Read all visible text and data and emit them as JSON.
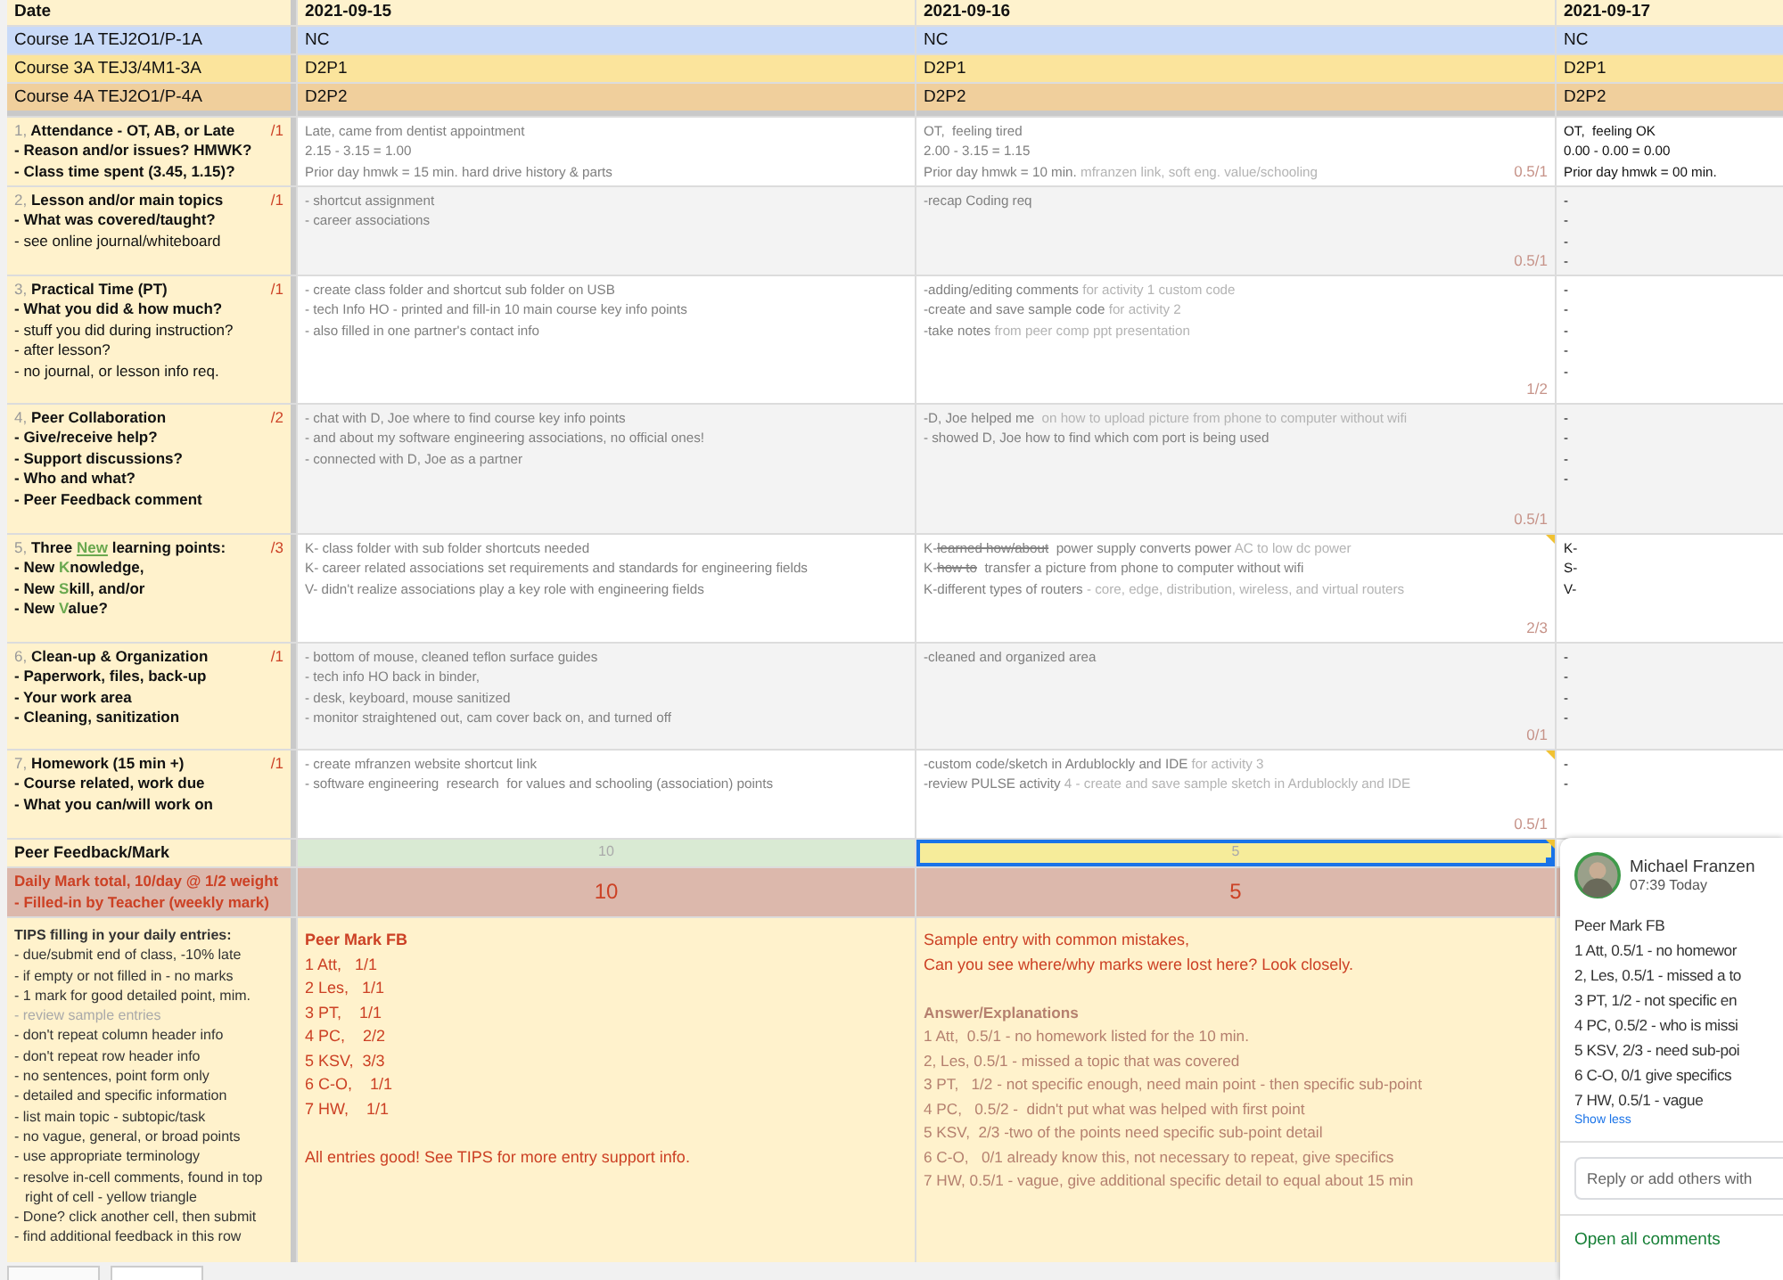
{
  "date_row": {
    "label": "Date",
    "dates": [
      "2021-09-15",
      "2021-09-16",
      "2021-09-17"
    ]
  },
  "courses": [
    {
      "label": "Course 1A TEJ2O1/P-1A",
      "values": [
        "NC",
        "NC",
        "NC"
      ],
      "color": "#c9daf8"
    },
    {
      "label": "Course 3A TEJ3/4M1-3A",
      "values": [
        "D2P1",
        "D2P1",
        "D2P1"
      ],
      "color": "#fbe49c"
    },
    {
      "label": "Course 4A TEJ2O1/P-4A",
      "values": [
        "D2P2",
        "D2P2",
        "D2P2"
      ],
      "color": "#f0cf9c"
    }
  ],
  "criteria": [
    {
      "number": "1,",
      "title": [
        {
          "text": "Attendance - OT, AB, or Late"
        }
      ],
      "max": "/1",
      "shaded": false,
      "lines": [
        {
          "text": "- Reason and/or issues? HMWK?",
          "bold": true
        },
        {
          "text": "- Class time spent (3.45, 1.15)?",
          "bold": true
        }
      ],
      "cells": [
        {
          "greyed": true,
          "lines": [
            "Late, came from dentist appointment",
            "2.15 - 3.15 = 1.00",
            "Prior day hmwk = 15 min. hard drive history & parts"
          ]
        },
        {
          "greyed": true,
          "lines": [
            "OT,  feeling tired",
            "2.00 - 3.15 = 1.15",
            [
              {
                "text": "Prior day hmwk = 10 min. "
              },
              {
                "text": "mfranzen link, soft eng. value/schooling",
                "kind": "faint"
              }
            ]
          ],
          "score": "0.5/1"
        },
        {
          "greyed": false,
          "lines": [
            "OT,  feeling OK",
            "0.00 - 0.00 = 0.00",
            "Prior day hmwk = 00 min."
          ]
        }
      ]
    },
    {
      "number": "2,",
      "title": [
        {
          "text": "Lesson and/or main topics"
        }
      ],
      "max": "/1",
      "shaded": true,
      "lines": [
        {
          "text": "- What was covered/taught?",
          "bold": true
        },
        {
          "text": "- see online journal/whiteboard",
          "bold": false
        }
      ],
      "cells": [
        {
          "greyed": true,
          "lines": [
            "- shortcut assignment",
            "- career associations"
          ]
        },
        {
          "greyed": true,
          "lines": [
            "-recap Coding req"
          ],
          "score": "0.5/1"
        },
        {
          "greyed": false,
          "lines": [
            "-",
            "-",
            "-",
            "-"
          ]
        }
      ]
    },
    {
      "number": "3,",
      "title": [
        {
          "text": "Practical Time (PT)"
        }
      ],
      "max": "/1",
      "shaded": false,
      "lines": [
        {
          "text": "- What you did & how much?",
          "bold": true
        },
        {
          "text": "- stuff you did during instruction?",
          "bold": false
        },
        {
          "text": "- after lesson?",
          "bold": false
        },
        {
          "text": "- no journal, or lesson info req.",
          "bold": false
        }
      ],
      "cells": [
        {
          "greyed": true,
          "lines": [
            "- create class folder and shortcut sub folder on USB",
            "- tech Info HO - printed and fill-in 10 main course key info points",
            "- also filled in one partner's contact info"
          ]
        },
        {
          "greyed": true,
          "lines": [
            [
              {
                "text": "-adding/editing comments "
              },
              {
                "text": "for activity 1 custom code",
                "kind": "faint"
              }
            ],
            [
              {
                "text": "-create and save sample code "
              },
              {
                "text": "for activity 2",
                "kind": "faint"
              }
            ],
            [
              {
                "text": "-take notes "
              },
              {
                "text": "from peer comp ppt presentation",
                "kind": "faint"
              }
            ]
          ],
          "score": "1/2"
        },
        {
          "greyed": false,
          "lines": [
            "-",
            "-",
            "-",
            "-",
            "-"
          ]
        }
      ]
    },
    {
      "number": "4,",
      "title": [
        {
          "text": "Peer Collaboration"
        }
      ],
      "max": "/2",
      "shaded": true,
      "lines": [
        {
          "text": "- Give/receive help?",
          "bold": true
        },
        {
          "text": "- Support discussions?",
          "bold": true
        },
        {
          "text": "- Who and what?",
          "bold": true
        },
        {
          "text": "- Peer Feedback comment",
          "bold": true
        }
      ],
      "cells": [
        {
          "greyed": true,
          "lines": [
            "- chat with D, Joe where to find course key info points",
            "- and about my software engineering associations, no official ones!",
            "- connected with D, Joe as a partner"
          ]
        },
        {
          "greyed": true,
          "lines": [
            [
              {
                "text": "-D, Joe helped me  "
              },
              {
                "text": "on how to upload picture from phone to computer without wifi",
                "kind": "faint"
              }
            ],
            "- showed D, Joe how to find which com port is being used"
          ],
          "score": "0.5/1"
        },
        {
          "greyed": false,
          "lines": [
            "-",
            "-",
            "-",
            "-"
          ]
        }
      ]
    },
    {
      "number": "5,",
      "title": [
        {
          "text": "Three "
        },
        {
          "text": "New",
          "kind": "accent-underline"
        },
        {
          "text": " learning points:"
        }
      ],
      "max": "/3",
      "shaded": false,
      "lines": [
        {
          "segments": [
            {
              "text": "- New "
            },
            {
              "text": "K",
              "kind": "accent"
            },
            {
              "text": "nowledge,"
            }
          ],
          "bold": true
        },
        {
          "segments": [
            {
              "text": "- New "
            },
            {
              "text": "S",
              "kind": "accent"
            },
            {
              "text": "kill, and/or"
            }
          ],
          "bold": true
        },
        {
          "segments": [
            {
              "text": "- New "
            },
            {
              "text": "V",
              "kind": "accent"
            },
            {
              "text": "alue?"
            }
          ],
          "bold": true
        }
      ],
      "cells": [
        {
          "greyed": true,
          "lines": [
            "K- class folder with sub folder shortcuts needed",
            "K- career related associations set requirements and standards for engineering fields",
            "V- didn't realize associations play a key role with engineering fields"
          ]
        },
        {
          "greyed": true,
          "lines": [
            [
              {
                "text": "K-"
              },
              {
                "text": "learned how/about",
                "kind": "struck"
              },
              {
                "text": "  power supply converts power "
              },
              {
                "text": "AC to low dc power",
                "kind": "faint"
              }
            ],
            [
              {
                "text": "K-"
              },
              {
                "text": "how to",
                "kind": "struck"
              },
              {
                "text": "  transfer a picture from phone to computer without wifi"
              }
            ],
            [
              {
                "text": "K-different types of routers "
              },
              {
                "text": "- core, edge, distribution, wireless, and virtual routers",
                "kind": "faint"
              }
            ]
          ],
          "score": "2/3",
          "comment": true
        },
        {
          "greyed": false,
          "lines": [
            "K-",
            "S-",
            "V-"
          ]
        }
      ]
    },
    {
      "number": "6,",
      "title": [
        {
          "text": "Clean-up & Organization"
        }
      ],
      "max": "/1",
      "shaded": true,
      "lines": [
        {
          "text": "- Paperwork, files, back-up",
          "bold": true
        },
        {
          "text": "- Your work area",
          "bold": true
        },
        {
          "text": "- Cleaning, sanitization",
          "bold": true
        }
      ],
      "cells": [
        {
          "greyed": true,
          "lines": [
            "- bottom of mouse, cleaned teflon surface guides",
            "- tech info HO back in binder,",
            "- desk, keyboard, mouse sanitized",
            "- monitor straightened out, cam cover back on, and turned off"
          ]
        },
        {
          "greyed": true,
          "lines": [
            "-cleaned and organized area"
          ],
          "score": "0/1"
        },
        {
          "greyed": false,
          "lines": [
            "-",
            "-",
            "-",
            "-"
          ]
        }
      ]
    },
    {
      "number": "7,",
      "title": [
        {
          "text": "Homework (15 min +)"
        }
      ],
      "max": "/1",
      "shaded": false,
      "lines": [
        {
          "text": "- Course related, work due",
          "bold": true
        },
        {
          "text": "- What you can/will work on",
          "bold": true
        }
      ],
      "cells": [
        {
          "greyed": true,
          "lines": [
            "- create mfranzen website shortcut link",
            "- software engineering  research  for values and schooling (association) points"
          ]
        },
        {
          "greyed": true,
          "lines": [
            [
              {
                "text": "-custom code/sketch in Ardublockly and IDE "
              },
              {
                "text": "for activity 3",
                "kind": "faint"
              }
            ],
            [
              {
                "text": "-review PULSE activity "
              },
              {
                "text": "4 - create and save sample sketch in Ardublockly and IDE",
                "kind": "faint"
              }
            ]
          ],
          "score": "0.5/1",
          "comment": true
        },
        {
          "greyed": false,
          "lines": [
            "-",
            "-"
          ]
        }
      ]
    }
  ],
  "peer_feedback": {
    "label": "Peer Feedback/Mark",
    "cells": [
      {
        "text": "10",
        "color": "#d9ead3",
        "selected": false,
        "comment": false
      },
      {
        "text": "5",
        "color": "#f6ec9a",
        "selected": true,
        "comment": true
      }
    ]
  },
  "daily_mark": {
    "lines": [
      "Daily Mark total, 10/day @ 1/2 weight",
      "- Filled-in by Teacher (weekly mark)"
    ],
    "values": [
      "10",
      "5"
    ]
  },
  "tips": {
    "title": "TIPS filling in your daily entries:",
    "lines": [
      {
        "text": "- due/submit end of class, -10% late",
        "faint": false
      },
      {
        "text": "- if empty or not filled in - no marks",
        "faint": false
      },
      {
        "text": "- 1 mark for good detailed point, mim.",
        "faint": false
      },
      {
        "text": "- review sample entries",
        "faint": true
      },
      {
        "text": "- don't repeat column header info",
        "faint": false
      },
      {
        "text": "- don't repeat row header info",
        "faint": false
      },
      {
        "text": "- no sentences, point form only",
        "faint": false
      },
      {
        "text": "- detailed and specific information",
        "faint": false
      },
      {
        "text": "- list main topic - subtopic/task",
        "faint": false
      },
      {
        "text": "- no vague, general, or broad points",
        "faint": false
      },
      {
        "text": "- use appropriate terminology",
        "faint": false
      },
      {
        "text": "- resolve in-cell comments, found in top right of cell - yellow triangle",
        "faint": false
      },
      {
        "text": "- Done? click another cell, then submit",
        "faint": false
      },
      {
        "text": "- find additional feedback in this row",
        "faint": false
      }
    ]
  },
  "notes": [
    {
      "blocks": [
        {
          "kind": "heading",
          "text": "Peer Mark FB"
        },
        {
          "kind": "line",
          "text": "1 Att,   1/1"
        },
        {
          "kind": "line",
          "text": "2 Les,   1/1"
        },
        {
          "kind": "line",
          "text": "3 PT,    1/1"
        },
        {
          "kind": "line",
          "text": "4 PC,    2/2"
        },
        {
          "kind": "line",
          "text": "5 KSV,  3/3"
        },
        {
          "kind": "line",
          "text": "6 C-O,    1/1"
        },
        {
          "kind": "line",
          "text": "7 HW,    1/1"
        },
        {
          "kind": "gap"
        },
        {
          "kind": "line",
          "text": "All entries good! See TIPS for more entry support info."
        }
      ]
    },
    {
      "blocks": [
        {
          "kind": "line",
          "text": "Sample entry with common mistakes,"
        },
        {
          "kind": "line",
          "text": "Can you see where/why marks were lost here? Look closely."
        },
        {
          "kind": "gap"
        },
        {
          "kind": "answer-heading",
          "text": "Answer/Explanations"
        },
        {
          "kind": "answer",
          "text": "1 Att,  0.5/1 - no homework listed for the 10 min."
        },
        {
          "kind": "answer",
          "text": "2, Les, 0.5/1 - missed a topic that was covered"
        },
        {
          "kind": "answer",
          "text": "3 PT,   1/2 - not specific enough, need main point - then specific sub-point"
        },
        {
          "kind": "answer",
          "text": "4 PC,   0.5/2 -  didn't put what was helped with first point"
        },
        {
          "kind": "answer",
          "text": "5 KSV,  2/3 -two of the points need specific sub-point detail"
        },
        {
          "kind": "answer",
          "text": "6 C-O,   0/1 already know this, not necessary to repeat, give specifics"
        },
        {
          "kind": "answer",
          "text": "7 HW, 0.5/1 - vague, give additional specific detail to equal about 15 min"
        }
      ]
    }
  ],
  "comment": {
    "author": "Michael Franzen",
    "time": "07:39 Today",
    "body": [
      "Peer Mark FB",
      "1 Att, 0.5/1 - no homewor",
      "2, Les, 0.5/1 - missed a to",
      "3 PT, 1/2 - not specific en",
      "4 PC, 0.5/2 - who is missi",
      "5 KSV, 2/3 - need sub-poi",
      "6 C-O, 0/1 give specifics",
      "7 HW, 0.5/1 - vague"
    ],
    "toggle": "Show less",
    "reply_placeholder": "Reply or add others with",
    "footer_link": "Open all comments"
  }
}
